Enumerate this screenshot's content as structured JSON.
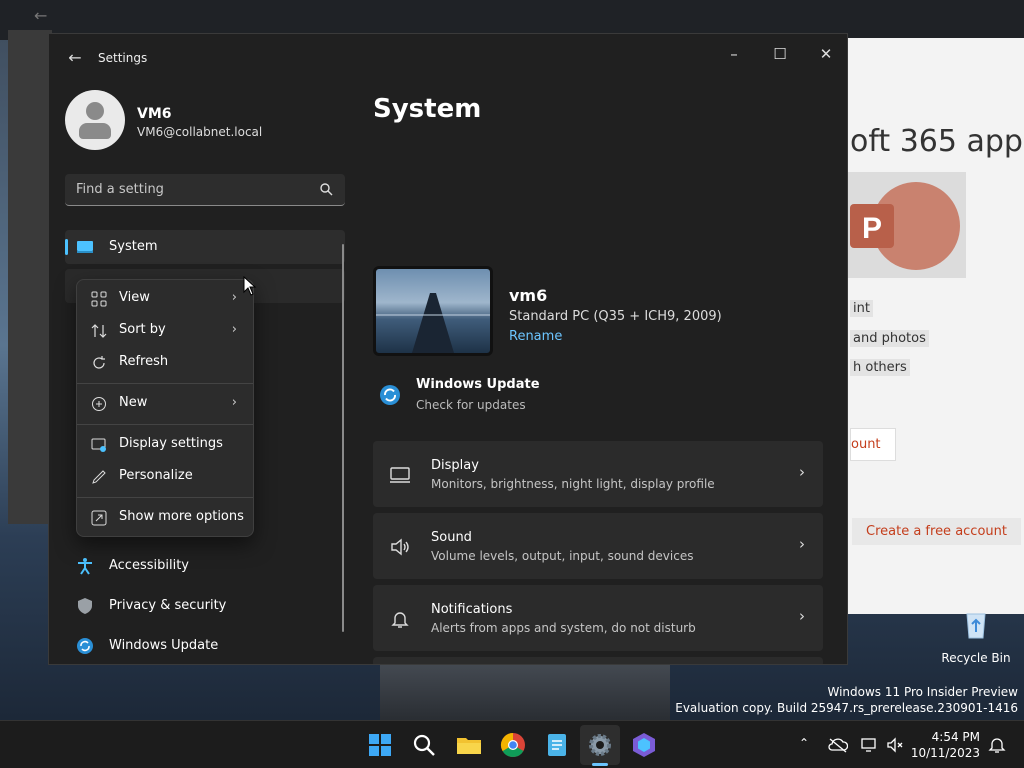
{
  "background": {
    "right_window": {
      "heading": "oft 365 app",
      "lines": [
        "int",
        "and photos",
        "h others"
      ],
      "button1": "ount",
      "button2": "Create a free account"
    },
    "desktop_icon": {
      "label": "Recycle Bin"
    },
    "watermark": {
      "line1": "Windows 11 Pro Insider Preview",
      "line2": "Evaluation copy. Build 25947.rs_prerelease.230901-1416"
    }
  },
  "window": {
    "title": "Settings",
    "controls": {
      "minimize": "–",
      "maximize": "☐",
      "close": "✕"
    }
  },
  "user": {
    "name": "VM6",
    "email": "VM6@collabnet.local"
  },
  "search": {
    "placeholder": "Find a setting"
  },
  "nav": {
    "selected": "System",
    "items": [
      {
        "label": "System",
        "icon": "monitor-icon"
      },
      {
        "label": "Accessibility",
        "icon": "accessibility-icon"
      },
      {
        "label": "Privacy & security",
        "icon": "shield-icon"
      },
      {
        "label": "Windows Update",
        "icon": "update-icon"
      }
    ]
  },
  "context_menu": {
    "items": [
      {
        "label": "View",
        "icon": "grid-icon",
        "submenu": true
      },
      {
        "label": "Sort by",
        "icon": "sort-icon",
        "submenu": true
      },
      {
        "label": "Refresh",
        "icon": "refresh-icon",
        "submenu": false
      },
      {
        "label": "New",
        "icon": "plus-circle-icon",
        "submenu": true
      },
      {
        "label": "Display settings",
        "icon": "display-settings-icon",
        "submenu": false
      },
      {
        "label": "Personalize",
        "icon": "pen-icon",
        "submenu": false
      },
      {
        "label": "Show more options",
        "icon": "more-options-icon",
        "submenu": false
      }
    ]
  },
  "main": {
    "title": "System",
    "device": {
      "name": "vm6",
      "model": "Standard PC (Q35 + ICH9, 2009)",
      "rename_label": "Rename"
    },
    "update": {
      "title": "Windows Update",
      "subtitle": "Check for updates"
    },
    "cards": [
      {
        "title": "Display",
        "subtitle": "Monitors, brightness, night light, display profile",
        "icon": "display-icon"
      },
      {
        "title": "Sound",
        "subtitle": "Volume levels, output, input, sound devices",
        "icon": "speaker-icon"
      },
      {
        "title": "Notifications",
        "subtitle": "Alerts from apps and system, do not disturb",
        "icon": "bell-icon"
      }
    ]
  },
  "taskbar": {
    "apps": [
      "start-icon",
      "search-icon",
      "file-explorer-icon",
      "chrome-icon",
      "notepad-icon",
      "settings-icon",
      "copilot-icon"
    ],
    "clock": {
      "time": "4:54 PM",
      "date": "10/11/2023"
    }
  },
  "colors": {
    "accent": "#4cc2ff",
    "link": "#6cc5ff",
    "window_bg": "#202020",
    "card_bg": "#2b2b2b"
  }
}
